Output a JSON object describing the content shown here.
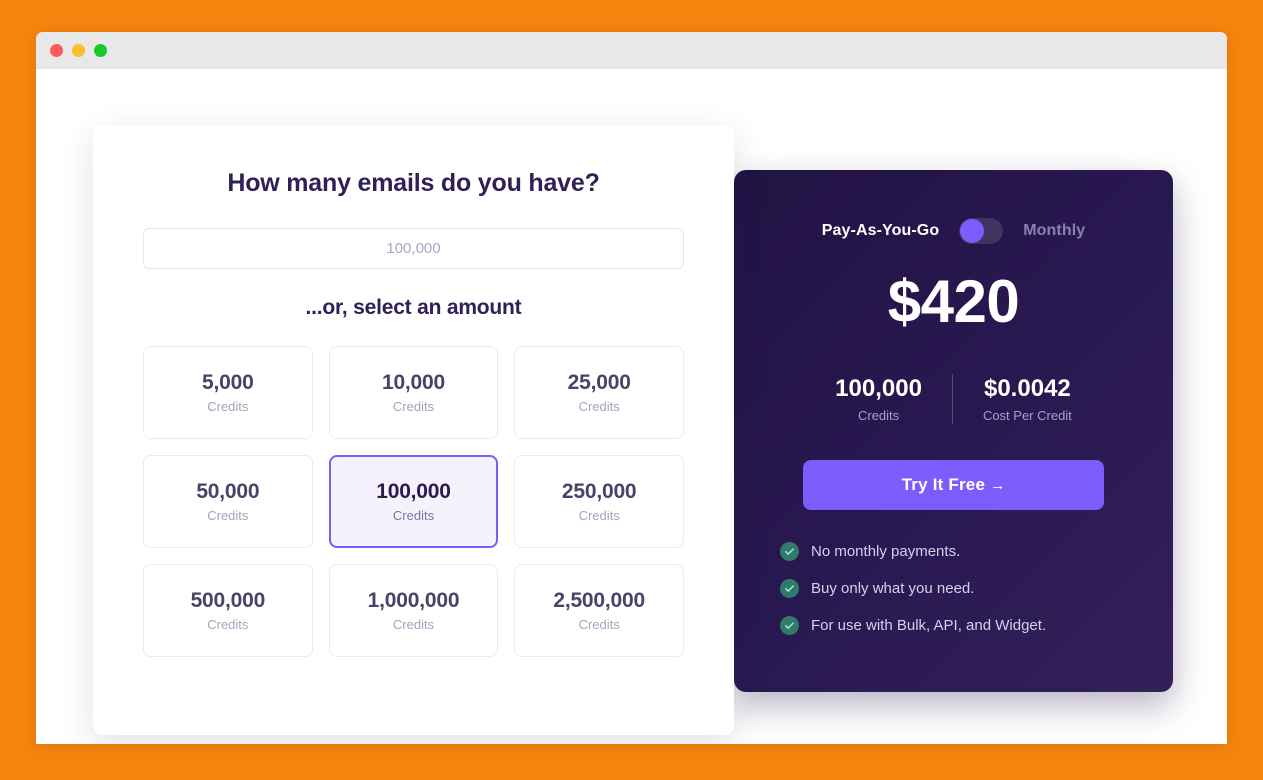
{
  "window": {
    "traffic_lights": [
      "close",
      "minimize",
      "maximize"
    ]
  },
  "calculator": {
    "title": "How many emails do you have?",
    "input_placeholder": "100,000",
    "input_value": "",
    "subtitle": "...or, select an amount",
    "unit_label": "Credits",
    "options": [
      {
        "amount": "5,000",
        "unit": "Credits",
        "selected": false
      },
      {
        "amount": "10,000",
        "unit": "Credits",
        "selected": false
      },
      {
        "amount": "25,000",
        "unit": "Credits",
        "selected": false
      },
      {
        "amount": "50,000",
        "unit": "Credits",
        "selected": false
      },
      {
        "amount": "100,000",
        "unit": "Credits",
        "selected": true
      },
      {
        "amount": "250,000",
        "unit": "Credits",
        "selected": false
      },
      {
        "amount": "500,000",
        "unit": "Credits",
        "selected": false
      },
      {
        "amount": "1,000,000",
        "unit": "Credits",
        "selected": false
      },
      {
        "amount": "2,500,000",
        "unit": "Credits",
        "selected": false
      }
    ]
  },
  "pricing": {
    "plan_left": "Pay-As-You-Go",
    "plan_right": "Monthly",
    "toggle_state": "pay-as-you-go",
    "price": "$420",
    "stats": [
      {
        "value": "100,000",
        "label": "Credits"
      },
      {
        "value": "$0.0042",
        "label": "Cost Per Credit"
      }
    ],
    "cta_label": "Try It Free",
    "cta_arrow": "→",
    "features": [
      "No monthly payments.",
      "Buy only what you need.",
      "For use with Bulk, API, and Widget."
    ]
  },
  "colors": {
    "background": "#f5840f",
    "accent_purple": "#7c5cfa",
    "panel_dark": "#281850",
    "heading": "#312058",
    "check_green": "#2f7a6b"
  }
}
